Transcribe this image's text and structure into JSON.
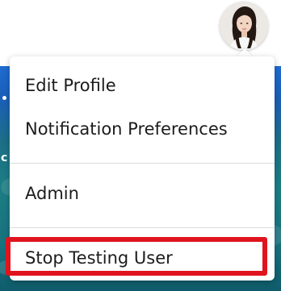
{
  "user_menu": {
    "items": [
      {
        "label": "Edit Profile"
      },
      {
        "label": "Notification Preferences"
      },
      {
        "label": "Admin"
      },
      {
        "label": "Stop Testing User"
      }
    ]
  },
  "colors": {
    "highlight": "#e0141e",
    "menu_background": "#ffffff",
    "text": "#1c1c1c",
    "background_page": "#1a5fb8"
  },
  "icons": {
    "avatar": "user-avatar-photo"
  }
}
